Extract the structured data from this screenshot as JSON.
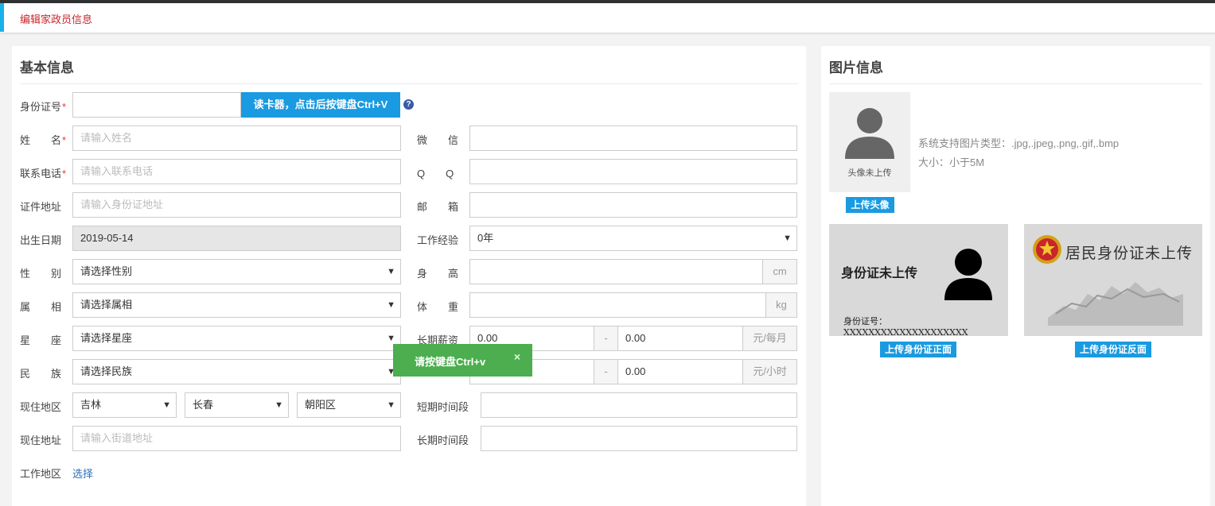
{
  "tab": {
    "title": "编辑家政员信息"
  },
  "basic": {
    "title": "基本信息",
    "id_number": {
      "label": "身份证号",
      "value": "",
      "read_card_button": "读卡器，点击后按键盘Ctrl+V",
      "help": "?"
    },
    "name": {
      "label": "姓　　名",
      "placeholder": "请输入姓名"
    },
    "phone": {
      "label": "联系电话",
      "placeholder": "请输入联系电话"
    },
    "id_address": {
      "label": "证件地址",
      "placeholder": "请输入身份证地址"
    },
    "birth_date": {
      "label": "出生日期",
      "value": "2019-05-14"
    },
    "gender": {
      "label": "性　　别",
      "value": "请选择性别"
    },
    "zodiac": {
      "label": "属　　相",
      "value": "请选择属相"
    },
    "constellation": {
      "label": "星　　座",
      "value": "请选择星座"
    },
    "ethnicity": {
      "label": "民　　族",
      "value": "请选择民族"
    },
    "current_region": {
      "label": "现住地区",
      "province": "吉林",
      "city": "长春",
      "district": "朝阳区"
    },
    "current_address": {
      "label": "现住地址",
      "placeholder": "请输入街道地址"
    },
    "work_region": {
      "label": "工作地区",
      "link": "选择"
    },
    "wechat": {
      "label": "微　　信",
      "value": ""
    },
    "qq": {
      "label": "Q　　Q",
      "value": ""
    },
    "email": {
      "label": "邮　　箱",
      "value": ""
    },
    "experience": {
      "label": "工作经验",
      "value": "0年"
    },
    "height": {
      "label": "身　　高",
      "value": "",
      "unit": "cm"
    },
    "weight": {
      "label": "体　　重",
      "value": "",
      "unit": "kg"
    },
    "long_salary": {
      "label": "长期薪资",
      "min": "0.00",
      "sep": "-",
      "max": "0.00",
      "unit": "元/每月"
    },
    "short_salary": {
      "min": "",
      "sep": "-",
      "max": "0.00",
      "unit": "元/小时"
    },
    "short_period": {
      "label": "短期时间段",
      "value": ""
    },
    "long_period": {
      "label": "长期时间段",
      "value": ""
    }
  },
  "toast": {
    "message": "请按键盘Ctrl+v",
    "close": "×"
  },
  "images": {
    "title": "图片信息",
    "avatar_caption": "头像未上传",
    "hint_types": "系统支持图片类型：.jpg,.jpeg,.png,.gif,.bmp",
    "hint_size": "大小：小于5M",
    "upload_avatar": "上传头像",
    "id_front_title": "身份证未上传",
    "id_front_number": "身份证号：XXXXXXXXXXXXXXXXXXXX",
    "id_back_title": "居民身份证未上传",
    "upload_front": "上传身份证正面",
    "upload_back": "上传身份证反面"
  },
  "colors": {
    "accent_blue": "#1a9ae0",
    "tab_red": "#c8262b",
    "toast_green": "#4cae4f"
  }
}
